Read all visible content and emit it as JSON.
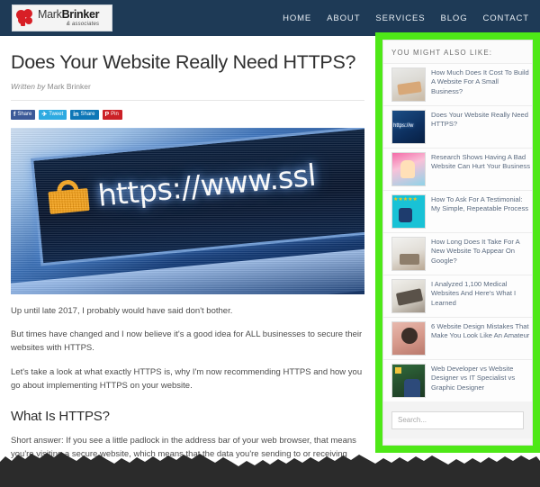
{
  "header": {
    "logo": {
      "name_light": "Mark",
      "name_bold": "Brinker",
      "tagline": "& associates"
    },
    "nav": [
      {
        "label": "HOME"
      },
      {
        "label": "ABOUT"
      },
      {
        "label": "SERVICES"
      },
      {
        "label": "BLOG"
      },
      {
        "label": "CONTACT"
      }
    ],
    "bg_color": "#1e3a56"
  },
  "article": {
    "title": "Does Your Website Really Need HTTPS?",
    "byline_prefix": "Written by",
    "byline_author": "Mark Brinker",
    "share_buttons": [
      {
        "icon": "facebook-icon",
        "glyph": "f",
        "label": "Share"
      },
      {
        "icon": "twitter-icon",
        "glyph": "✈",
        "label": "Tweet"
      },
      {
        "icon": "linkedin-icon",
        "glyph": "in",
        "label": "Share"
      },
      {
        "icon": "pinterest-icon",
        "glyph": "P",
        "label": "Pin"
      }
    ],
    "hero": {
      "alt": "Browser address bar showing a padlock and a secure URL",
      "url_text": "https://www.ssl",
      "lock_icon": "padlock-icon"
    },
    "paragraphs": [
      "Up until late 2017, I probably would have said don't bother.",
      "But times have changed and I now believe it's a good idea for ALL businesses to secure their websites with HTTPS.",
      "Let's take a look at what exactly HTTPS is, why I'm now recommending HTTPS and how you go about implementing HTTPS on your website."
    ],
    "section_heading": "What Is HTTPS?",
    "section_paragraph": "Short answer: If you see a little padlock in the address bar of your web browser, that means you're visiting a secure website, which means that the data you're sending to or receiving"
  },
  "sidebar": {
    "heading": "YOU MIGHT ALSO LIKE:",
    "highlight_color": "#4ee817",
    "items": [
      {
        "title": "How Much Does It Cost To Build A Website For A Small Business?",
        "thumb": "thumbnail-cost-website"
      },
      {
        "title": "Does Your Website Really Need HTTPS?",
        "thumb": "thumbnail-https-bar"
      },
      {
        "title": "Research Shows Having A Bad Website Can Hurt Your Business",
        "thumb": "thumbnail-bad-website"
      },
      {
        "title": "How To Ask For A Testimonial: My Simple, Repeatable Process",
        "thumb": "thumbnail-testimonial"
      },
      {
        "title": "How Long Does It Take For A New Website To Appear On Google?",
        "thumb": "thumbnail-new-website"
      },
      {
        "title": "I Analyzed 1,100 Medical Websites And Here's What I Learned",
        "thumb": "thumbnail-medical-websites"
      },
      {
        "title": "6 Website Design Mistakes That Make You Look Like An Amateur",
        "thumb": "thumbnail-design-mistakes"
      },
      {
        "title": "Web Developer vs Website Designer vs IT Specialist vs Graphic Designer",
        "thumb": "thumbnail-web-developer"
      }
    ],
    "search": {
      "placeholder": "Search...",
      "value": ""
    }
  }
}
